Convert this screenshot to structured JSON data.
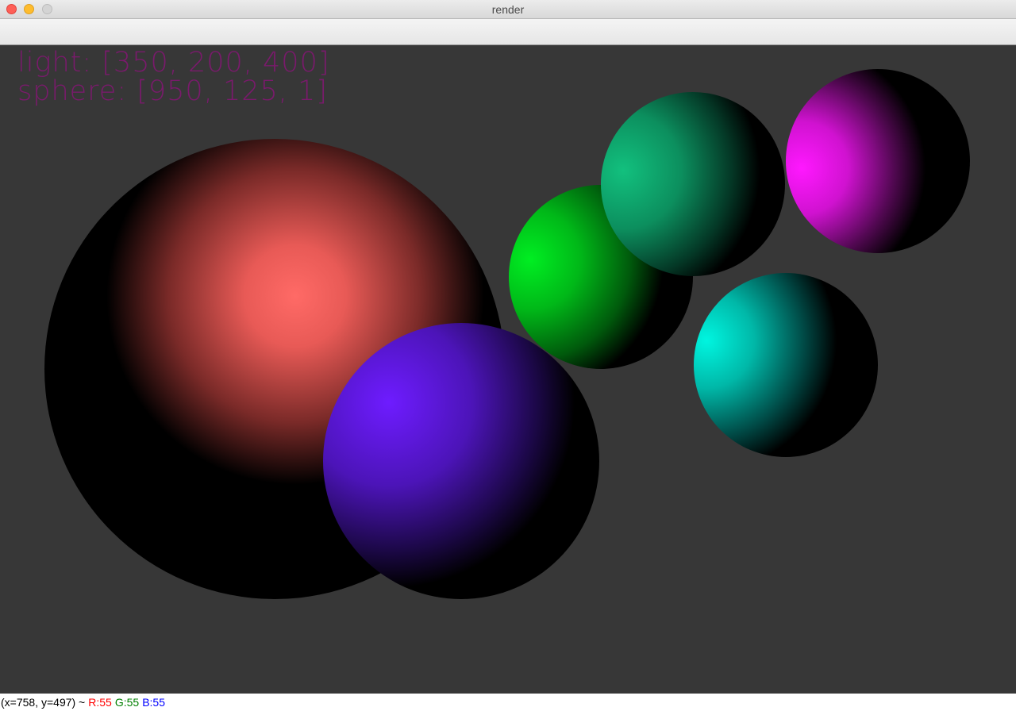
{
  "window": {
    "title": "render"
  },
  "overlay": {
    "light_line": "light: [350, 200, 400]",
    "sphere_line": "sphere: [950, 125, 1]",
    "text_color": "#7a1a6c"
  },
  "scene": {
    "background_color": "#373737",
    "spheres": [
      {
        "name": "red",
        "color": "#ff6a66"
      },
      {
        "name": "violet",
        "color": "#6a1aff"
      },
      {
        "name": "green",
        "color": "#00ee22"
      },
      {
        "name": "teal",
        "color": "#10c07c"
      },
      {
        "name": "magenta",
        "color": "#ff18ff"
      },
      {
        "name": "cyan",
        "color": "#00f5e0"
      }
    ]
  },
  "statusbar": {
    "coords": "(x=758, y=497) ~",
    "r": "R:55",
    "g": "G:55",
    "b": "B:55",
    "r_color": "#ff0000",
    "g_color": "#008000",
    "b_color": "#0000ff"
  }
}
